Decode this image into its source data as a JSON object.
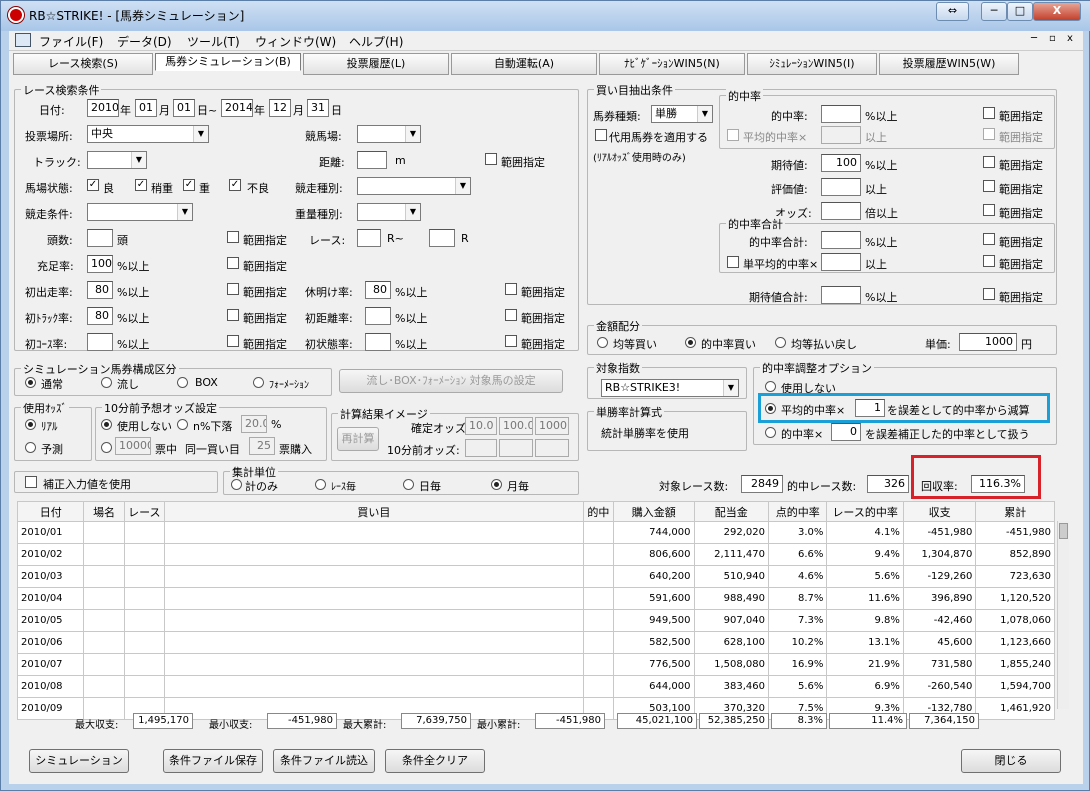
{
  "window": {
    "title": "RB☆STRIKE! - [馬券シミュレーション]",
    "controls": [
      "⇔",
      "─",
      "□",
      "X"
    ],
    "inner_controls": [
      "─",
      "▫",
      "x"
    ]
  },
  "menu": [
    "ファイル(F)",
    "データ(D)",
    "ツール(T)",
    "ウィンドウ(W)",
    "ヘルプ(H)"
  ],
  "tabs": [
    "レース検索(S)",
    "馬券シミュレーション(B)",
    "投票履歴(L)",
    "自動運転(A)",
    "ﾅﾋﾞｹﾞｰｼｮﾝWIN5(N)",
    "ｼﾐｭﾚｰｼｮﾝWIN5(I)",
    "投票履歴WIN5(W)"
  ],
  "race_search": {
    "legend": "レース検索条件",
    "date_label": "日付:",
    "date_from": {
      "y": "2010",
      "m": "01",
      "d": "01"
    },
    "date_to": {
      "y": "2014",
      "m": "12",
      "d": "31"
    },
    "u_year": "年",
    "u_month": "月",
    "u_day_from": "日~",
    "u_day": "日",
    "venue_label": "投票場所:",
    "venue": "中央",
    "course_label": "競馬場:",
    "track_label": "トラック:",
    "distance_label": "距離:",
    "distance_unit": "m",
    "range_label": "範囲指定",
    "condition_label": "馬場状態:",
    "cond_good": "良",
    "cond_slight": "稍重",
    "cond_heavy": "重",
    "cond_bad": "不良",
    "race_type_label": "競走種別:",
    "race_cond_label": "競走条件:",
    "weight_label": "重量種別:",
    "heads_label": "頭数:",
    "heads_unit": "頭",
    "race_label": "レース:",
    "race_mid": "R~",
    "race_end": "R",
    "fill_label": "充足率:",
    "fill_value": "100",
    "above": "%以上",
    "first_run_label": "初出走率:",
    "first_run_value": "80",
    "rest_label": "休明け率:",
    "rest_value": "80",
    "first_track_label": "初ﾄﾗｯｸ率:",
    "first_track_value": "80",
    "first_dist_label": "初距離率:",
    "first_course_label": "初ｺｰｽ率:",
    "first_cond_label": "初状態率:"
  },
  "composition": {
    "legend": "シミュレーション馬券構成区分",
    "options": [
      "通常",
      "流し",
      "BOX",
      "ﾌｫｰﾒｰｼｮﾝ"
    ],
    "selected": "通常",
    "target_button": "流し･BOX･ﾌｫｰﾒｰｼｮﾝ 対象馬の設定"
  },
  "odds_use": {
    "legend": "使用ｵｯｽﾞ",
    "options": [
      "ﾘｱﾙ",
      "予測"
    ],
    "selected": "ﾘｱﾙ"
  },
  "pre10": {
    "legend": "10分前予想オッズ設定",
    "not_use": "使用しない",
    "drop": "n%下落",
    "drop_value": "20.0",
    "pct": "%",
    "mid_value": "10000",
    "mid_label": "票中",
    "same": "同一買い目",
    "same_value": "25",
    "buy": "票購入"
  },
  "calc_image": {
    "legend": "計算結果イメージ",
    "recalc": "再計算",
    "fixed_label": "確定オッズ:",
    "fixed_values": [
      "10.0",
      "100.0",
      "1000"
    ],
    "pre_label": "10分前オッズ:"
  },
  "correction_label": "補正入力値を使用",
  "agg_unit": {
    "legend": "集計単位",
    "options": [
      "計のみ",
      "ﾚｰｽ毎",
      "日毎",
      "月毎"
    ],
    "selected": "月毎"
  },
  "buy_extract": {
    "legend": "買い目抽出条件",
    "ticket_type_label": "馬券種類:",
    "ticket_type": "単勝",
    "substitute": "代用馬券を適用する",
    "real_note": "(ﾘｱﾙｵｯｽﾞ使用時のみ)",
    "hit_rate_legend": "的中率",
    "hit_rate_label": "的中率:",
    "avg_hit_label": "平均的中率×",
    "expect_label": "期待値:",
    "expect_value": "100",
    "eval_label": "評価値:",
    "odds_label": "オッズ:",
    "hit_sum_legend": "的中率合計",
    "hit_sum_label": "的中率合計:",
    "single_avg_label": "単平均的中率×",
    "expect_sum_label": "期待値合計:",
    "above": "以上",
    "pct_above": "%以上",
    "times_above": "倍以上",
    "range_label": "範囲指定"
  },
  "money": {
    "legend": "金額配分",
    "options": [
      "均等買い",
      "的中率買い",
      "均等払い戻し"
    ],
    "selected": "的中率買い",
    "unit_label": "単価:",
    "unit_value": "1000",
    "yen": "円"
  },
  "target_index": {
    "legend": "対象指数",
    "value": "RB☆STRIKE3!"
  },
  "win_calc": {
    "legend": "単勝率計算式",
    "value": "統計単勝率を使用"
  },
  "hit_adjust": {
    "legend": "的中率調整オプション",
    "not_use": "使用しない",
    "avg_label": "平均的中率×",
    "avg_value": "1",
    "avg_suffix": "を誤差として的中率から減算",
    "hit_label": "的中率×",
    "hit_value": "0",
    "hit_suffix": "を誤差補正した的中率として扱う",
    "selected": "avg"
  },
  "stats": {
    "target_races_label": "対象レース数:",
    "target_races": "2849",
    "hit_races_label": "的中レース数:",
    "hit_races": "326",
    "recovery_label": "回収率:",
    "recovery": "116.3%"
  },
  "table": {
    "headers": [
      "日付",
      "場名",
      "レース",
      "買い目",
      "的中",
      "購入金額",
      "配当金",
      "点的中率",
      "レース的中率",
      "収支",
      "累計"
    ],
    "rows": [
      [
        "2010/01",
        "",
        "",
        "",
        "",
        "744,000",
        "292,020",
        "3.0%",
        "4.1%",
        "-451,980",
        "-451,980"
      ],
      [
        "2010/02",
        "",
        "",
        "",
        "",
        "806,600",
        "2,111,470",
        "6.6%",
        "9.4%",
        "1,304,870",
        "852,890"
      ],
      [
        "2010/03",
        "",
        "",
        "",
        "",
        "640,200",
        "510,940",
        "4.6%",
        "5.6%",
        "-129,260",
        "723,630"
      ],
      [
        "2010/04",
        "",
        "",
        "",
        "",
        "591,600",
        "988,490",
        "8.7%",
        "11.6%",
        "396,890",
        "1,120,520"
      ],
      [
        "2010/05",
        "",
        "",
        "",
        "",
        "949,500",
        "907,040",
        "7.3%",
        "9.8%",
        "-42,460",
        "1,078,060"
      ],
      [
        "2010/06",
        "",
        "",
        "",
        "",
        "582,500",
        "628,100",
        "10.2%",
        "13.1%",
        "45,600",
        "1,123,660"
      ],
      [
        "2010/07",
        "",
        "",
        "",
        "",
        "776,500",
        "1,508,080",
        "16.9%",
        "21.9%",
        "731,580",
        "1,855,240"
      ],
      [
        "2010/08",
        "",
        "",
        "",
        "",
        "644,000",
        "383,460",
        "5.6%",
        "6.9%",
        "-260,540",
        "1,594,700"
      ],
      [
        "2010/09",
        "",
        "",
        "",
        "",
        "503,100",
        "370,320",
        "7.5%",
        "9.3%",
        "-132,780",
        "1,461,920"
      ]
    ]
  },
  "summary": {
    "max_balance_label": "最大収支:",
    "max_balance": "1,495,170",
    "min_balance_label": "最小収支:",
    "min_balance": "-451,980",
    "max_cum_label": "最大累計:",
    "max_cum": "7,639,750",
    "min_cum_label": "最小累計:",
    "min_cum": "-451,980",
    "total_buy": "45,021,100",
    "total_payout": "52,385,250",
    "total_point_hit": "8.3%",
    "total_race_hit": "11.4%",
    "total_balance": "7,364,150"
  },
  "buttons": {
    "simulate": "シミュレーション",
    "save": "条件ファイル保存",
    "load": "条件ファイル読込",
    "clear": "条件全クリア",
    "close": "閉じる"
  }
}
